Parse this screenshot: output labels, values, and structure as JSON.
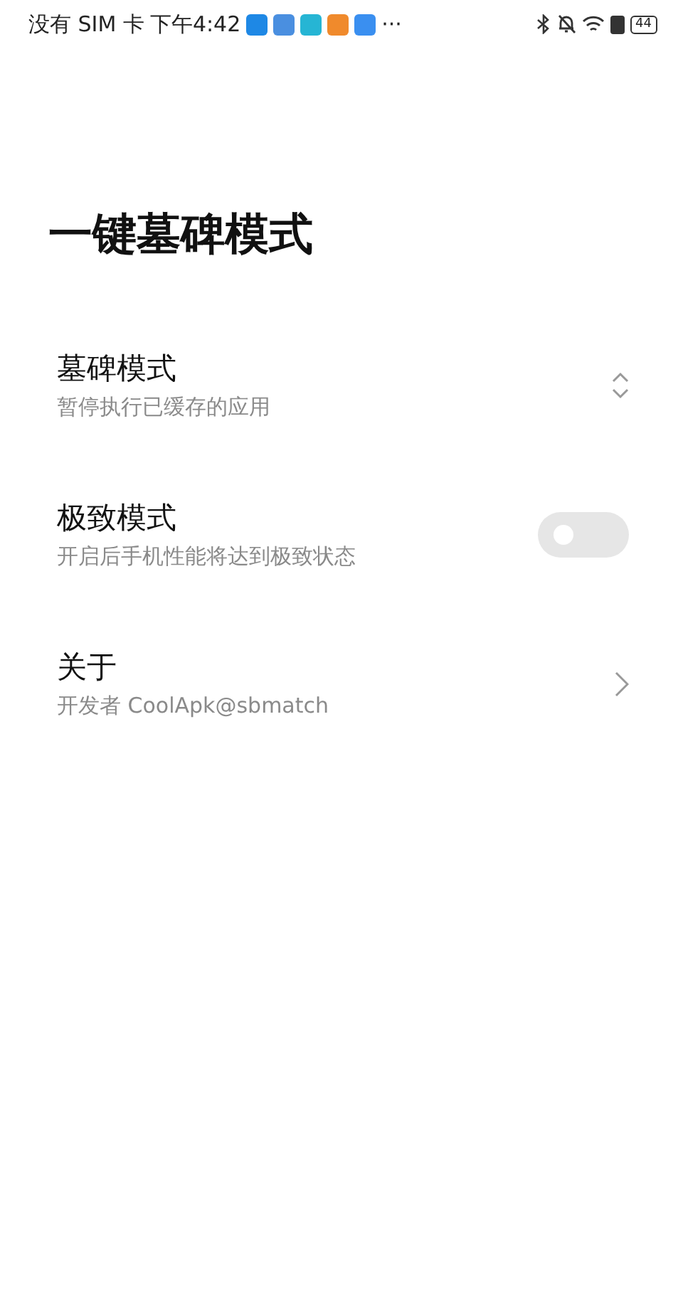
{
  "status_bar": {
    "carrier": "没有 SIM 卡",
    "time": "下午4:42",
    "more": "···",
    "battery": "44"
  },
  "title": "一键墓碑模式",
  "items": [
    {
      "kind": "dropdown",
      "title": "墓碑模式",
      "subtitle": "暂停执行已缓存的应用"
    },
    {
      "kind": "switch",
      "title": "极致模式",
      "subtitle": "开启后手机性能将达到极致状态",
      "on": false
    },
    {
      "kind": "link",
      "title": "关于",
      "subtitle": "开发者 CoolApk@sbmatch"
    }
  ]
}
